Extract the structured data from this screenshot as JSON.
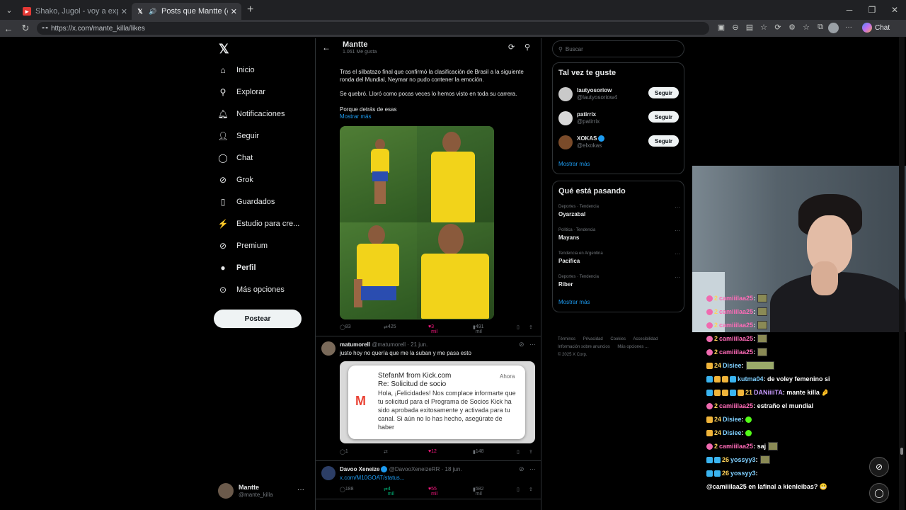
{
  "browser": {
    "tabs": [
      {
        "title": "Shako, Jugol - voy a explotar el b",
        "active": false
      },
      {
        "title": "Posts que Mantte (@mante_k",
        "active": true
      }
    ],
    "url": "https://x.com/mante_killa/likes",
    "chat_label": "Chat"
  },
  "nav": {
    "items": [
      {
        "label": "Inicio",
        "icon": "home-icon"
      },
      {
        "label": "Explorar",
        "icon": "search-icon"
      },
      {
        "label": "Notificaciones",
        "icon": "bell-icon"
      },
      {
        "label": "Seguir",
        "icon": "add-person-icon"
      },
      {
        "label": "Chat",
        "icon": "chat-icon"
      },
      {
        "label": "Grok",
        "icon": "grok-icon"
      },
      {
        "label": "Guardados",
        "icon": "bookmark-icon"
      },
      {
        "label": "Estudio para cre...",
        "icon": "studio-icon"
      },
      {
        "label": "Premium",
        "icon": "premium-icon"
      },
      {
        "label": "Perfil",
        "icon": "person-icon"
      },
      {
        "label": "Más opciones",
        "icon": "more-icon"
      }
    ],
    "post_button": "Postear",
    "me": {
      "name": "Mantte",
      "handle": "@mante_killa"
    }
  },
  "header": {
    "name": "Mantte",
    "sub": "1.061 Me gusta"
  },
  "tweet1": {
    "line1": "Tras el silbatazo final que confirmó la clasificación de Brasil a la siguiente ronda del Mundial, Neymar no pudo contener la emoción.",
    "line2": "Se quebró. Lloró como pocas veces lo hemos visto en toda su carrera.",
    "line3": "Porque detrás de esas",
    "show_more": "Mostrar más",
    "replies": "83",
    "retweets": "425",
    "likes": "3 mil",
    "views": "491 mil"
  },
  "tweet2": {
    "name": "matumorell",
    "handle": "@matumorell · 21 jun.",
    "text": "justo hoy no quería que me la suban y me pasa esto",
    "notif": {
      "from": "StefanM from Kick.com",
      "time": "Ahora",
      "subject": "Re: Solicitud de socio",
      "body": "Hola, ¡Felicidades! Nos complace informarte que tu solicitud para el Programa de Socios Kick ha sido aprobada exitosamente y activada para tu canal. Si aún no lo has hecho, asegúrate de haber"
    },
    "replies": "1",
    "retweets": "",
    "likes": "12",
    "views": "148"
  },
  "tweet3": {
    "name": "Davoo Xeneize",
    "handle": "@DavooXeneizeRR · 18 jun.",
    "text": "x.com/M10GOAT/status...",
    "replies": "188",
    "retweets": "4 mil",
    "likes": "55 mil",
    "views": "582 mil"
  },
  "sidebar": {
    "search_placeholder": "Buscar",
    "suggest_title": "Tal vez te guste",
    "suggestions": [
      {
        "name": "lautyosoriow",
        "handle": "@lautyosoriow4",
        "button": "Seguir"
      },
      {
        "name": "patirrix",
        "handle": "@patirrix",
        "button": "Seguir"
      },
      {
        "name": "XOKAS",
        "handle": "@elxokas",
        "button": "Seguir"
      }
    ],
    "suggest_more": "Mostrar más",
    "trends_title": "Qué está pasando",
    "trends": [
      {
        "category": "Deportes · Tendencia",
        "title": "Oyarzabal"
      },
      {
        "category": "Política · Tendencia",
        "title": "Mayans"
      },
      {
        "category": "Tendencia en Argentina",
        "title": "Pacifica"
      },
      {
        "category": "Deportes · Tendencia",
        "title": "Riber"
      }
    ],
    "trends_more": "Mostrar más",
    "footer": [
      "Términos",
      "Privacidad",
      "Cookies",
      "Accesibilidad",
      "Información sobre anuncios",
      "Más opciones ...",
      "© 2025 X Corp."
    ]
  },
  "chat": [
    {
      "num": "2",
      "user": "camiiilaa25",
      "text": ""
    },
    {
      "num": "2",
      "user": "camiiilaa25",
      "text": ""
    },
    {
      "num": "2",
      "user": "camiiilaa25",
      "text": ""
    },
    {
      "num": "2",
      "user": "camiiilaa25",
      "text": ""
    },
    {
      "num": "2",
      "user": "camiiilaa25",
      "text": ""
    },
    {
      "num": "24",
      "user": "Disiee",
      "text": ""
    },
    {
      "num": "",
      "user": "kutma04",
      "text": "de voley femenino si"
    },
    {
      "num": "21",
      "user": "DANiiiiTA",
      "text": "mante killa"
    },
    {
      "num": "2",
      "user": "camiiilaa25",
      "text": "estraño el mundial"
    },
    {
      "num": "24",
      "user": "Disiee",
      "text": ""
    },
    {
      "num": "24",
      "user": "Disiee",
      "text": ""
    },
    {
      "num": "2",
      "user": "camiiilaa25",
      "text": "saj"
    },
    {
      "num": "26",
      "user": "yossyy3",
      "text": ""
    },
    {
      "num": "26",
      "user": "yossyy3",
      "text": ""
    },
    {
      "num": "",
      "user": "",
      "text": "@camiiilaa25 en lafinal a kienleibas?"
    }
  ]
}
